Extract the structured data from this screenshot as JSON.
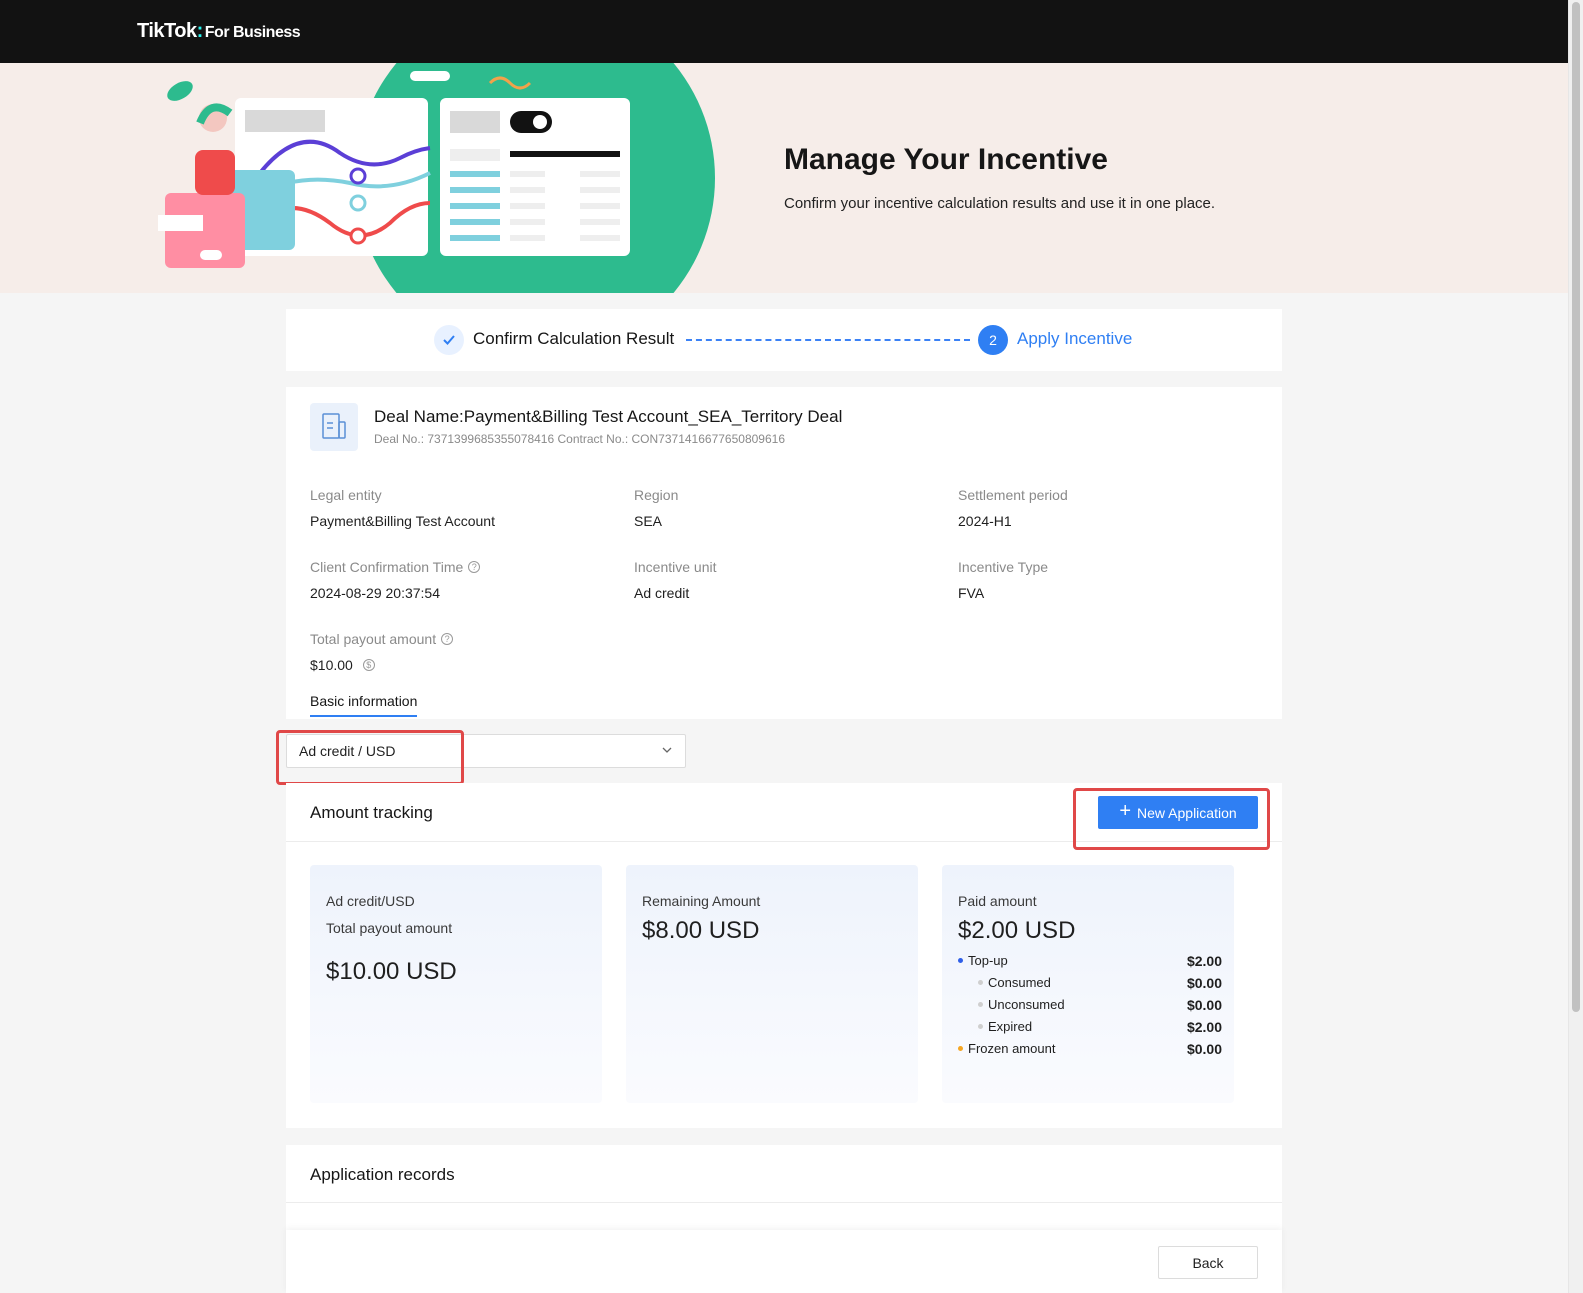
{
  "header": {
    "brand": "TikTok",
    "brand_sub": "For Business"
  },
  "banner": {
    "title": "Manage Your Incentive",
    "subtitle": "Confirm your incentive calculation results and use it in one place."
  },
  "steps": [
    {
      "label": "Confirm Calculation Result",
      "status": "done"
    },
    {
      "number": "2",
      "label": "Apply Incentive",
      "status": "active"
    }
  ],
  "deal": {
    "name": "Deal Name:Payment&Billing Test Account_SEA_Territory Deal",
    "meta": "Deal No.: 7371399685355078416  Contract No.: CON7371416677650809616",
    "fields": {
      "legal_entity": {
        "label": "Legal entity",
        "value": "Payment&Billing Test Account"
      },
      "region": {
        "label": "Region",
        "value": "SEA"
      },
      "settlement_period": {
        "label": "Settlement period",
        "value": "2024-H1"
      },
      "client_confirmation_time": {
        "label": "Client Confirmation Time",
        "value": "2024-08-29 20:37:54"
      },
      "incentive_unit": {
        "label": "Incentive unit",
        "value": "Ad credit"
      },
      "incentive_type": {
        "label": "Incentive Type",
        "value": "FVA"
      },
      "total_payout": {
        "label": "Total payout amount",
        "value": "$10.00"
      }
    },
    "tab": "Basic information"
  },
  "currency_select": {
    "value": "Ad credit / USD"
  },
  "amount_tracking": {
    "title": "Amount tracking",
    "new_button": "New Application",
    "total": {
      "line1": "Ad credit/USD",
      "line2": "Total payout amount",
      "amount": "$10.00 USD"
    },
    "remaining": {
      "label": "Remaining Amount",
      "amount": "$8.00 USD"
    },
    "paid": {
      "label": "Paid amount",
      "amount": "$2.00 USD",
      "rows": [
        {
          "label": "Top-up",
          "value": "$2.00"
        },
        {
          "label": "Consumed",
          "value": "$0.00"
        },
        {
          "label": "Unconsumed",
          "value": "$0.00"
        },
        {
          "label": "Expired",
          "value": "$2.00"
        },
        {
          "label": "Frozen amount",
          "value": "$0.00"
        }
      ]
    }
  },
  "records": {
    "title": "Application records"
  },
  "footer": {
    "back_button": "Back"
  },
  "colors": {
    "accent": "#2f7ff3",
    "highlight": "#e04848",
    "topbar": "#121212"
  }
}
